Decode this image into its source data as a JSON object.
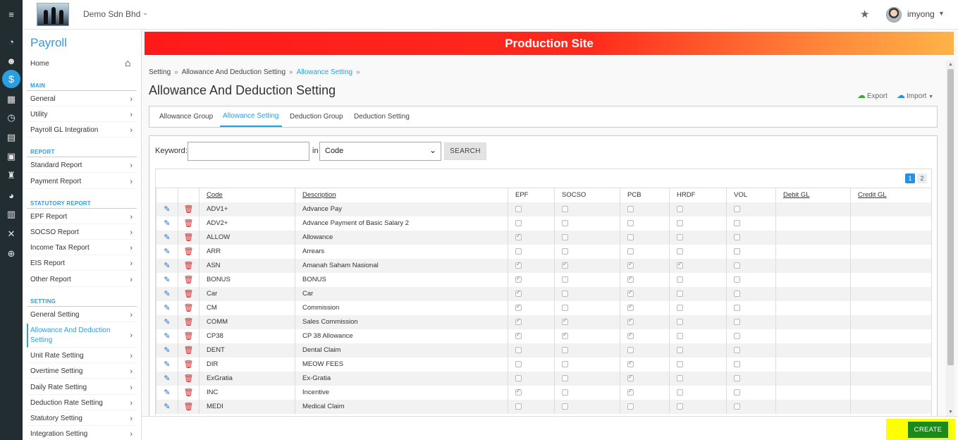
{
  "topbar": {
    "company": "Demo Sdn Bhd",
    "username": "imyong"
  },
  "sidebar": {
    "title": "Payroll",
    "home_label": "Home",
    "sections": [
      {
        "label": "MAIN",
        "items": [
          "General",
          "Utility",
          "Payroll GL Integration"
        ]
      },
      {
        "label": "REPORT",
        "items": [
          "Standard Report",
          "Payment Report"
        ]
      },
      {
        "label": "STATUTORY REPORT",
        "items": [
          "EPF Report",
          "SOCSO Report",
          "Income Tax Report",
          "EIS Report",
          "Other Report"
        ]
      },
      {
        "label": "SETTING",
        "items": [
          "General Setting",
          "Allowance And Deduction Setting",
          "Unit Rate Setting",
          "Overtime Setting",
          "Daily Rate Setting",
          "Deduction Rate Setting",
          "Statutory Setting",
          "Integration Setting"
        ]
      }
    ]
  },
  "banner": {
    "text": "Production Site"
  },
  "breadcrumb": [
    "Setting",
    "Allowance And Deduction Setting",
    "Allowance Setting"
  ],
  "page": {
    "title": "Allowance And Deduction Setting",
    "export_label": "Export",
    "import_label": "Import"
  },
  "tabs": [
    "Allowance Group",
    "Allowance Setting",
    "Deduction Group",
    "Deduction Setting"
  ],
  "search": {
    "keyword_label": "Keyword:",
    "in_label": "in",
    "select_value": "Code",
    "button_label": "SEARCH"
  },
  "pagination": [
    "1",
    "2"
  ],
  "table": {
    "headers": [
      "Code",
      "Description",
      "EPF",
      "SOCSO",
      "PCB",
      "HRDF",
      "VOL",
      "Debit GL",
      "Credit GL"
    ],
    "rows": [
      {
        "code": "ADV1+",
        "desc": "Advance Pay",
        "epf": false,
        "socso": false,
        "pcb": false,
        "hrdf": false,
        "vol": false
      },
      {
        "code": "ADV2+",
        "desc": "Advance Payment of Basic Salary 2",
        "epf": false,
        "socso": false,
        "pcb": false,
        "hrdf": false,
        "vol": false
      },
      {
        "code": "ALLOW",
        "desc": "Allowance",
        "epf": true,
        "socso": false,
        "pcb": false,
        "hrdf": false,
        "vol": false
      },
      {
        "code": "ARR",
        "desc": "Arrears",
        "epf": false,
        "socso": false,
        "pcb": false,
        "hrdf": false,
        "vol": false
      },
      {
        "code": "ASN",
        "desc": "Amanah Saham Nasional",
        "epf": true,
        "socso": true,
        "pcb": true,
        "hrdf": true,
        "vol": false
      },
      {
        "code": "BONUS",
        "desc": "BONUS",
        "epf": true,
        "socso": false,
        "pcb": true,
        "hrdf": false,
        "vol": false
      },
      {
        "code": "Car",
        "desc": "Car",
        "epf": true,
        "socso": false,
        "pcb": true,
        "hrdf": false,
        "vol": false
      },
      {
        "code": "CM",
        "desc": "Commission",
        "epf": true,
        "socso": false,
        "pcb": true,
        "hrdf": false,
        "vol": false
      },
      {
        "code": "COMM",
        "desc": "Sales Commission",
        "epf": true,
        "socso": true,
        "pcb": true,
        "hrdf": false,
        "vol": false
      },
      {
        "code": "CP38",
        "desc": "CP 38 Allowance",
        "epf": true,
        "socso": true,
        "pcb": true,
        "hrdf": false,
        "vol": false
      },
      {
        "code": "DENT",
        "desc": "Dental Claim",
        "epf": false,
        "socso": false,
        "pcb": false,
        "hrdf": false,
        "vol": false
      },
      {
        "code": "DIR",
        "desc": "MEOW FEES",
        "epf": false,
        "socso": false,
        "pcb": true,
        "hrdf": false,
        "vol": false
      },
      {
        "code": "ExGratia",
        "desc": "Ex-Gratia",
        "epf": false,
        "socso": false,
        "pcb": true,
        "hrdf": false,
        "vol": false
      },
      {
        "code": "INC",
        "desc": "Incentive",
        "epf": true,
        "socso": false,
        "pcb": true,
        "hrdf": false,
        "vol": false
      },
      {
        "code": "MEDI",
        "desc": "Medical Claim",
        "epf": false,
        "socso": false,
        "pcb": false,
        "hrdf": false,
        "vol": false
      }
    ]
  },
  "footer": {
    "create_label": "CREATE"
  },
  "icons": {
    "menu": "hamburger-icon",
    "star": "star-icon",
    "home": "home-icon",
    "edit": "pencil-icon",
    "delete": "trash-icon",
    "export": "cloud-download-icon",
    "import": "cloud-upload-icon"
  },
  "colors": {
    "accent": "#2a9fe0",
    "banner_start": "#ff1a1a",
    "banner_end": "#ffb347",
    "create": "#1b8a1b",
    "highlight": "#ffff00",
    "rail": "#222d32"
  }
}
